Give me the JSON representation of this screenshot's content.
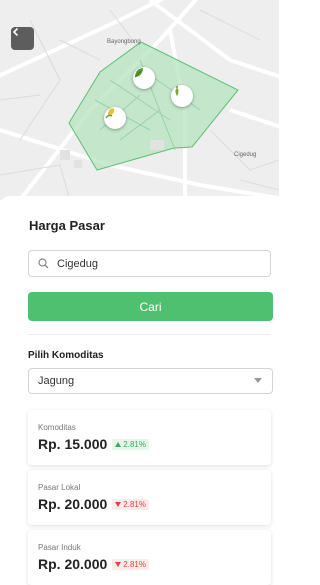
{
  "map": {
    "labels": {
      "north": "Bayongbong",
      "east": "Cigedug"
    }
  },
  "page_title": "Harga Pasar",
  "search": {
    "value": "Cigedug",
    "button_label": "Cari"
  },
  "commodity": {
    "label": "Pilih Komoditas",
    "selected": "Jagung"
  },
  "cards": [
    {
      "label": "Komoditas",
      "price": "Rp. 15.000",
      "change": "2.81%",
      "direction": "up"
    },
    {
      "label": "Pasar Lokal",
      "price": "Rp. 20.000",
      "change": "2.81%",
      "direction": "down"
    },
    {
      "label": "Pasar Induk",
      "price": "Rp. 20.000",
      "change": "2.81%",
      "direction": "down"
    }
  ],
  "colors": {
    "accent": "#4fbf70",
    "up": "#38a85b",
    "down": "#e0443e",
    "area_fill": "#b9e6c3"
  }
}
